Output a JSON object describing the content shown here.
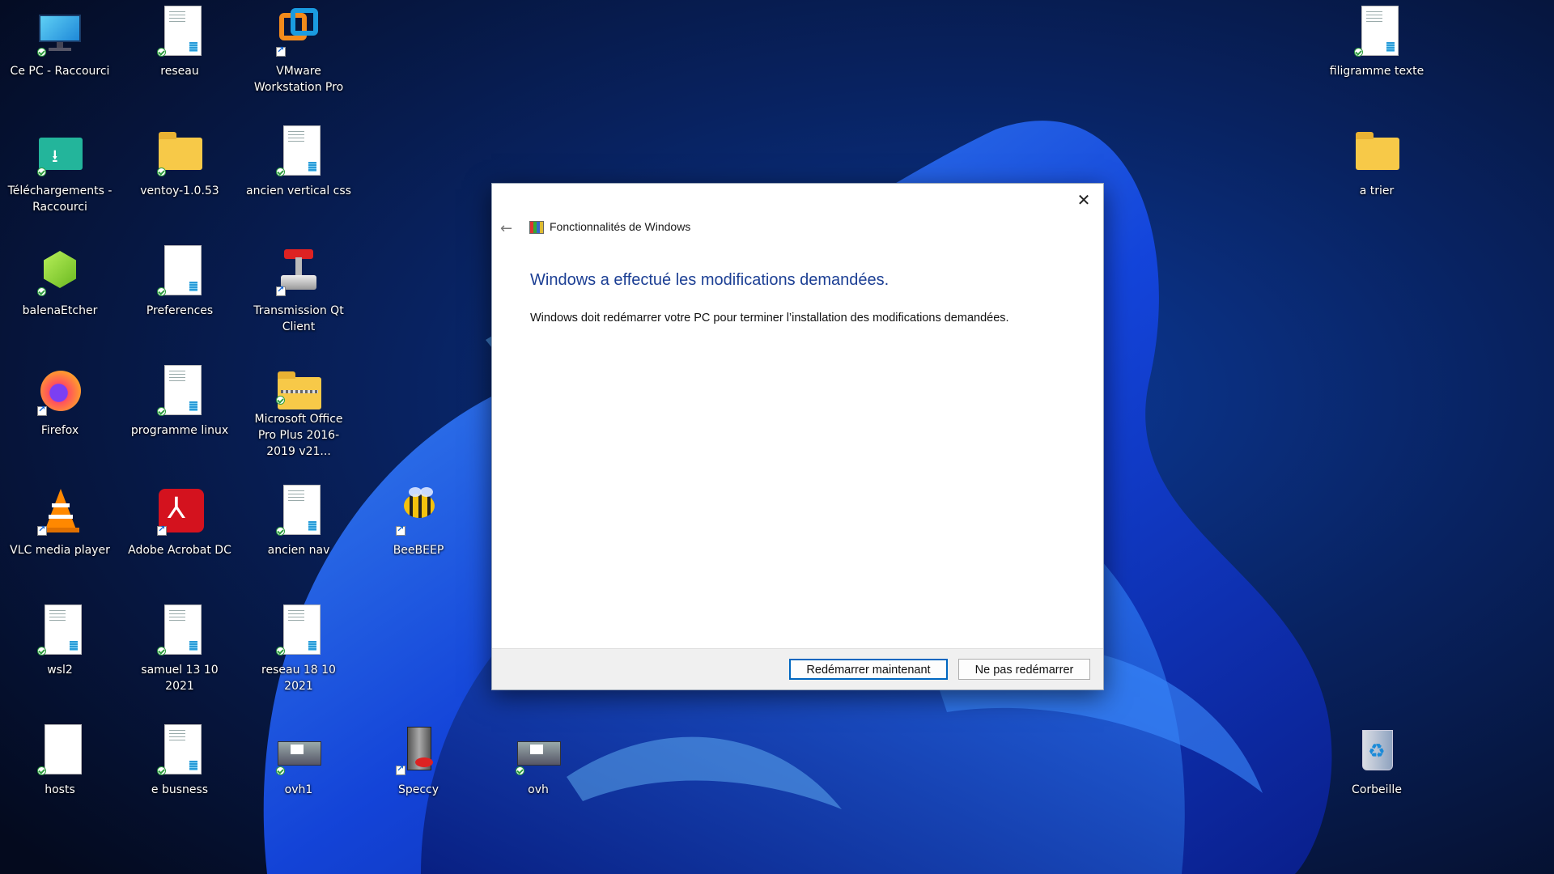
{
  "desktop": {
    "icons": [
      {
        "label": "Ce PC - Raccourci",
        "icon": "monitor-icon"
      },
      {
        "label": "reseau",
        "icon": "document-icon"
      },
      {
        "label": "VMware Workstation Pro",
        "icon": "vmware-icon"
      },
      {
        "label": "filigramme texte",
        "icon": "document-icon"
      },
      {
        "label": "Téléchargements - Raccourci",
        "icon": "downloads-folder-icon"
      },
      {
        "label": "ventoy-1.0.53",
        "icon": "folder-icon"
      },
      {
        "label": "ancien vertical css",
        "icon": "document-icon"
      },
      {
        "label": "a trier",
        "icon": "folder-icon"
      },
      {
        "label": "balenaEtcher",
        "icon": "balenaetcher-icon"
      },
      {
        "label": "Preferences",
        "icon": "document-icon"
      },
      {
        "label": "Transmission Qt Client",
        "icon": "transmission-icon"
      },
      {
        "label": "Firefox",
        "icon": "firefox-icon"
      },
      {
        "label": "programme linux",
        "icon": "document-icon"
      },
      {
        "label": "Microsoft Office Pro Plus 2016-2019 v21...",
        "icon": "zip-folder-icon"
      },
      {
        "label": "VLC media player",
        "icon": "vlc-icon"
      },
      {
        "label": "Adobe Acrobat DC",
        "icon": "acrobat-icon"
      },
      {
        "label": "ancien nav",
        "icon": "document-icon"
      },
      {
        "label": "BeeBEEP",
        "icon": "bee-icon"
      },
      {
        "label": "wsl2",
        "icon": "document-icon"
      },
      {
        "label": "samuel 13 10 2021",
        "icon": "document-icon"
      },
      {
        "label": "reseau 18 10 2021",
        "icon": "document-icon"
      },
      {
        "label": "hosts",
        "icon": "file-icon"
      },
      {
        "label": "e busness",
        "icon": "document-icon"
      },
      {
        "label": "ovh1",
        "icon": "rdp-icon"
      },
      {
        "label": "Speccy",
        "icon": "speccy-icon"
      },
      {
        "label": "ovh",
        "icon": "rdp-icon"
      },
      {
        "label": "Corbeille",
        "icon": "recycle-bin-icon"
      }
    ]
  },
  "dialog": {
    "title": "Fonctionnalités de Windows",
    "heading": "Windows a effectué les modifications demandées.",
    "message": "Windows doit redémarrer votre PC pour terminer l’installation des modifications demandées.",
    "restart_label": "Redémarrer maintenant",
    "no_restart_label": "Ne pas redémarrer",
    "close_symbol": "✕",
    "back_symbol": "←"
  },
  "colors": {
    "heading": "#1c3f94",
    "accent": "#0067c0"
  }
}
